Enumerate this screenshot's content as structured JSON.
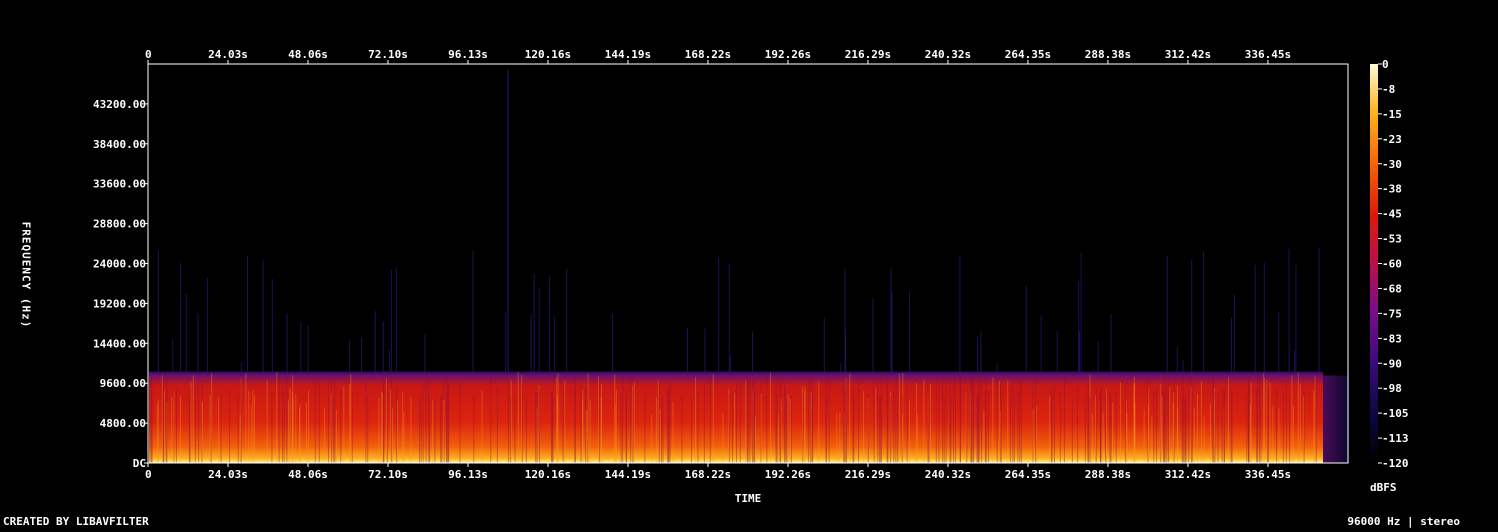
{
  "chart_data": {
    "type": "heatmap",
    "title": "",
    "xlabel": "TIME",
    "ylabel": "FREQUENCY (Hz)",
    "x_ticks": [
      "0",
      "24.03s",
      "48.06s",
      "72.10s",
      "96.13s",
      "120.16s",
      "144.19s",
      "168.22s",
      "192.26s",
      "216.29s",
      "240.32s",
      "264.35s",
      "288.38s",
      "312.42s",
      "336.45s"
    ],
    "x_tick_values_s": [
      0,
      24.03,
      48.06,
      72.1,
      96.13,
      120.16,
      144.19,
      168.22,
      192.26,
      216.29,
      240.32,
      264.35,
      288.38,
      312.42,
      336.45
    ],
    "xlim_s": [
      0,
      360.5
    ],
    "y_ticks": [
      "DC",
      "4800.00",
      "9600.00",
      "14400.00",
      "19200.00",
      "24000.00",
      "28800.00",
      "33600.00",
      "38400.00",
      "43200.00"
    ],
    "y_tick_values_hz": [
      0,
      4800,
      9600,
      14400,
      19200,
      24000,
      28800,
      33600,
      38400,
      43200
    ],
    "ylim_hz": [
      0,
      48000
    ],
    "content_cutoff_hz": 11000,
    "content_end_s": 353,
    "colorbar": {
      "unit": "dBFS",
      "ticks": [
        "0",
        "-8",
        "-15",
        "-23",
        "-30",
        "-38",
        "-45",
        "-53",
        "-60",
        "-68",
        "-75",
        "-83",
        "-90",
        "-98",
        "-105",
        "-113",
        "-120"
      ],
      "range": [
        -120,
        0
      ]
    },
    "colors": {
      "background": "#000000",
      "low": "#0a0820",
      "mid": "#cc1a0e",
      "high": "#fff8b0"
    }
  },
  "footer": {
    "credit": "CREATED BY LIBAVFILTER",
    "info": "96000 Hz | stereo"
  }
}
